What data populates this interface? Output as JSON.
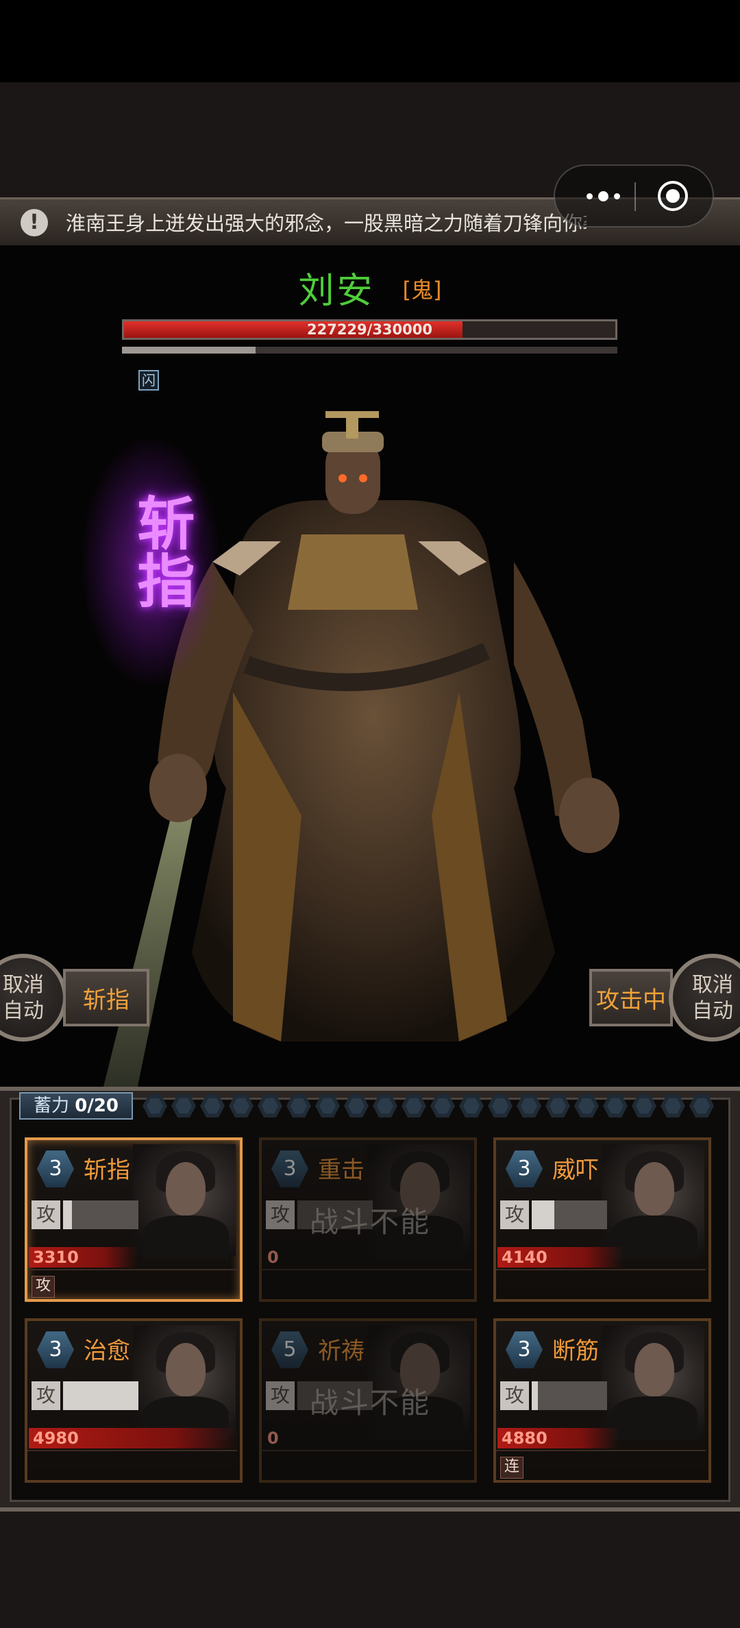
{
  "notice": {
    "text": "淮南王身上迸发出强大的邪念，一股黑暗之力随着刀锋向你袭来"
  },
  "boss": {
    "name": "刘安",
    "tag": "[鬼]",
    "hp_text": "227229/330000",
    "hp_current": 227229,
    "hp_max": 330000,
    "sub_bar_fraction": 0.27,
    "status_badge": "闪"
  },
  "skill_effect": {
    "text": "斩指"
  },
  "controls": {
    "left_cancel_auto": "取消\n自动",
    "left_skill": "斩指",
    "right_attacking": "攻击中",
    "right_cancel_auto": "取消\n自动"
  },
  "charge": {
    "label": "蓄力",
    "value": "0/20",
    "gem_count": 20,
    "filled": 0
  },
  "cards": [
    {
      "level": "3",
      "name": "斩指",
      "atk_tag": "攻",
      "atk_fraction": 0.12,
      "power": "3310",
      "power_fraction": 0.52,
      "cannot": "",
      "tag": "攻",
      "state": "active"
    },
    {
      "level": "3",
      "name": "重击",
      "atk_tag": "攻",
      "atk_fraction": 0.0,
      "power": "0",
      "power_fraction": 0.0,
      "cannot": "战斗不能",
      "tag": "",
      "state": "dim"
    },
    {
      "level": "3",
      "name": "威吓",
      "atk_tag": "攻",
      "atk_fraction": 0.3,
      "power": "4140",
      "power_fraction": 0.6,
      "cannot": "",
      "tag": "",
      "state": "normal"
    },
    {
      "level": "3",
      "name": "治愈",
      "atk_tag": "攻",
      "atk_fraction": 1.0,
      "power": "4980",
      "power_fraction": 1.0,
      "cannot": "",
      "tag": "",
      "state": "normal"
    },
    {
      "level": "5",
      "name": "祈祷",
      "atk_tag": "攻",
      "atk_fraction": 0.0,
      "power": "0",
      "power_fraction": 0.0,
      "cannot": "战斗不能",
      "tag": "",
      "state": "dim"
    },
    {
      "level": "3",
      "name": "断筋",
      "atk_tag": "攻",
      "atk_fraction": 0.08,
      "power": "4880",
      "power_fraction": 0.58,
      "cannot": "",
      "tag": "连",
      "state": "normal"
    }
  ]
}
